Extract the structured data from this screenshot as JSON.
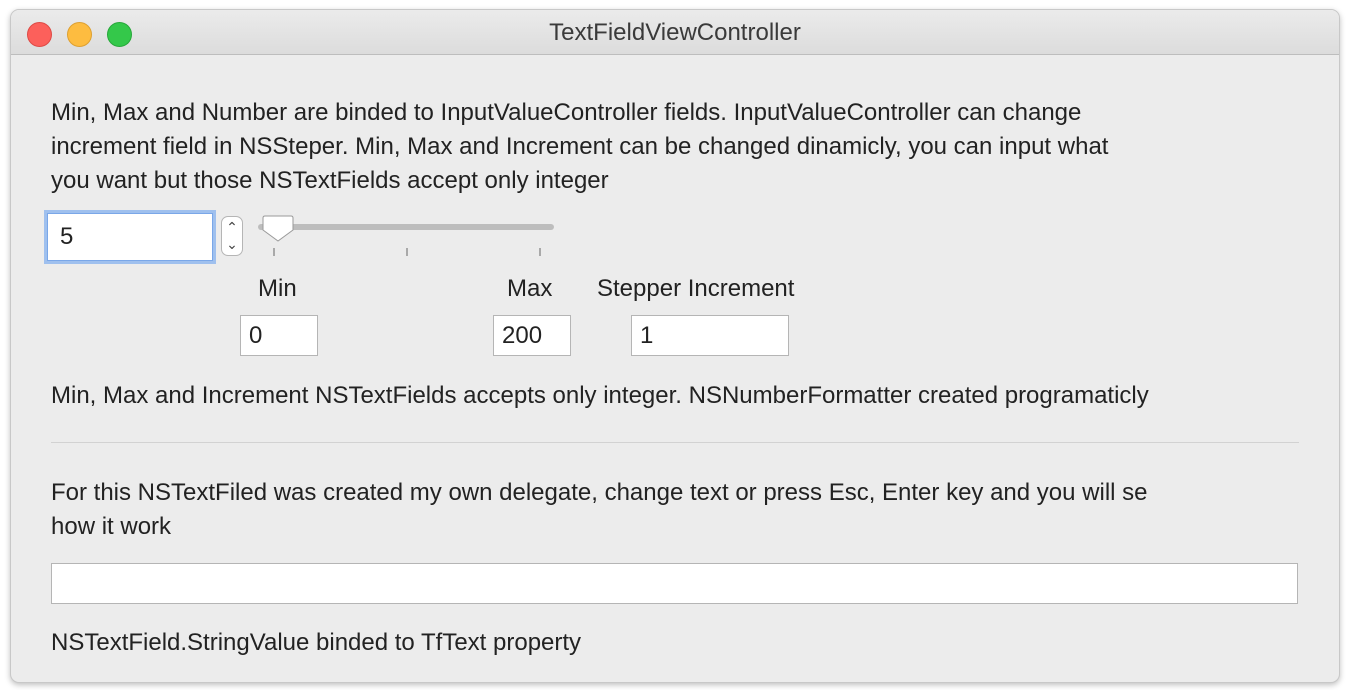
{
  "window": {
    "title": "TextFieldViewController"
  },
  "intro": {
    "line1": "Min, Max and Number are binded to InputValueController fields. InputValueController can change",
    "line2": "increment field in NSSteper. Min, Max and Increment can be changed dinamicly, you can input what",
    "line3": "you want but those NSTextFields accept only integer"
  },
  "number_field": {
    "value": "5"
  },
  "stepper": {
    "up_icon": "chevron-up-icon",
    "down_icon": "chevron-down-icon"
  },
  "slider": {
    "value": 5,
    "min": 0,
    "max": 200
  },
  "min": {
    "label": "Min",
    "value": "0"
  },
  "max": {
    "label": "Max",
    "value": "200"
  },
  "increment": {
    "label": "Stepper Increment",
    "value": "1"
  },
  "note": "Min, Max and Increment NSTextFields accepts only integer. NSNumberFormatter created programaticly",
  "delegate": {
    "line1": "For this NSTextFiled was created my own delegate, change text or press Esc, Enter key and you will se",
    "line2": "how it work",
    "text_value": ""
  },
  "footer": "NSTextField.StringValue binded to TfText property"
}
